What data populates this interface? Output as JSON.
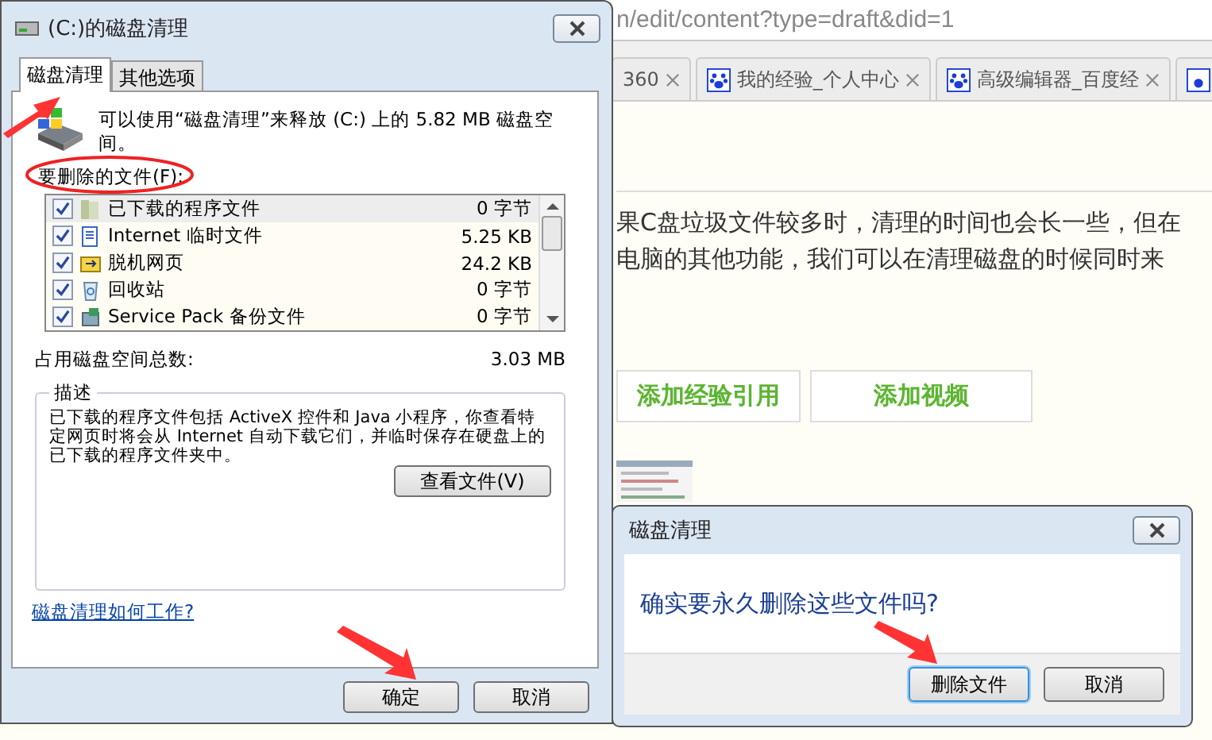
{
  "browser": {
    "url": "n/edit/content?type=draft&did=1",
    "tabs": [
      {
        "label": "360",
        "kind": "plain"
      },
      {
        "label": "我的经验_个人中心",
        "kind": "paw"
      },
      {
        "label": "高级编辑器_百度经",
        "kind": "paw"
      },
      {
        "kind": "paw-only"
      }
    ],
    "paragraph_lines": [
      "果C盘垃圾文件较多时，清理的时间也会长一些，但在",
      "电脑的其他功能，我们可以在清理磁盘的时候同时来"
    ],
    "action_buttons": [
      "添加经验引用",
      "添加视频"
    ]
  },
  "dialog": {
    "title": "(C:)的磁盘清理",
    "tabs": [
      {
        "label": "磁盘清理",
        "selected": true
      },
      {
        "label": "其他选项",
        "selected": false
      }
    ],
    "intro": "可以使用“磁盘清理”来释放  (C:) 上的 5.82 MB 磁盘空间。",
    "files_label": "要删除的文件(F):",
    "files": [
      {
        "name": "已下载的程序文件",
        "size": "0 字节",
        "checked": true,
        "selected": true,
        "kind": "folder"
      },
      {
        "name": "Internet 临时文件",
        "size": "5.25 KB",
        "checked": true,
        "selected": false,
        "kind": "page"
      },
      {
        "name": "脱机网页",
        "size": "24.2 KB",
        "checked": true,
        "selected": false,
        "kind": "offline"
      },
      {
        "name": "回收站",
        "size": "0 字节",
        "checked": true,
        "selected": false,
        "kind": "recycle"
      },
      {
        "name": "Service Pack 备份文件",
        "size": "0 字节",
        "checked": true,
        "selected": false,
        "kind": "pack"
      }
    ],
    "total_label": "占用磁盘空间总数:",
    "total_value": "3.03 MB",
    "description": {
      "title": "描述",
      "text": "已下载的程序文件包括 ActiveX 控件和 Java 小程序，你查看特定网页时将会从 Internet 自动下载它们，并临时保存在硬盘上的已下载的程序文件夹中。"
    },
    "view_files_button": "查看文件(V)",
    "help_link": "磁盘清理如何工作?",
    "buttons": [
      "确定",
      "取消"
    ]
  },
  "confirm": {
    "title": "磁盘清理",
    "message": "确实要永久删除这些文件吗?",
    "buttons": [
      {
        "label": "删除文件",
        "focused": true
      },
      {
        "label": "取消",
        "focused": false
      }
    ]
  }
}
